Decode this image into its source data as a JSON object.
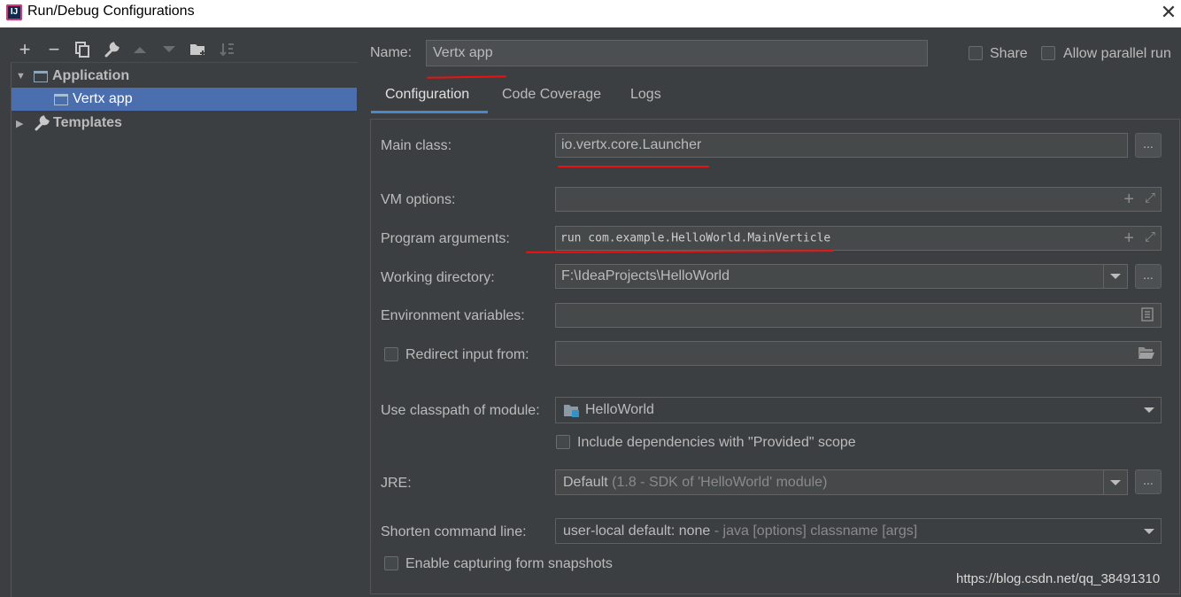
{
  "window": {
    "title": "Run/Debug Configurations",
    "app_icon_text": "IJ"
  },
  "toolbar": {
    "add": "+",
    "remove": "−"
  },
  "tree": {
    "items": [
      {
        "label": "Application"
      },
      {
        "label": "Vertx app"
      },
      {
        "label": "Templates"
      }
    ]
  },
  "header": {
    "name_label": "Name:",
    "name_value": "Vertx app",
    "share_label": "Share",
    "parallel_label": "Allow parallel run"
  },
  "tabs": [
    {
      "label": "Configuration",
      "active": true
    },
    {
      "label": "Code Coverage",
      "active": false
    },
    {
      "label": "Logs",
      "active": false
    }
  ],
  "form": {
    "main_class_label": "Main class:",
    "main_class_value": "io.vertx.core.Launcher",
    "vm_options_label": "VM options:",
    "vm_options_value": "",
    "program_args_label": "Program arguments:",
    "program_args_value": "run com.example.HelloWorld.MainVerticle",
    "working_dir_label": "Working directory:",
    "working_dir_value": "F:\\IdeaProjects\\HelloWorld",
    "env_vars_label": "Environment variables:",
    "env_vars_value": "",
    "redirect_label": "Redirect input from:",
    "redirect_value": "",
    "classpath_label": "Use classpath of module:",
    "classpath_value": "HelloWorld",
    "include_deps_label": "Include dependencies with \"Provided\" scope",
    "jre_label": "JRE:",
    "jre_value": "Default",
    "jre_detail": "(1.8 - SDK of 'HelloWorld' module)",
    "shorten_label": "Shorten command line:",
    "shorten_value": "user-local default: none",
    "shorten_detail": "- java [options] classname [args]",
    "snapshots_label": "Enable capturing form snapshots",
    "browse_label": "..."
  },
  "watermark": "https://blog.csdn.net/qq_38491310",
  "colors": {
    "background": "#3c3f41",
    "selection": "#4b6eaf",
    "annotation": "#e11111"
  }
}
